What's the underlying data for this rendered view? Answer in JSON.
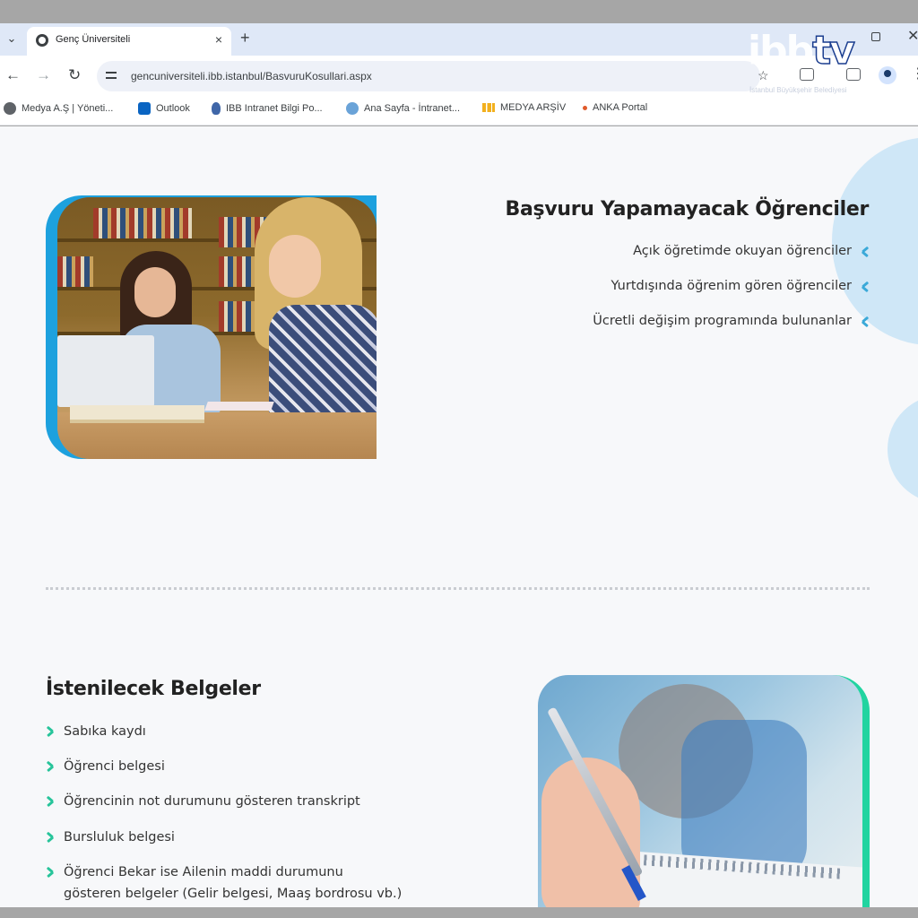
{
  "browser": {
    "tab_title": "Genç Üniversiteli",
    "tab_close": "×",
    "new_tab": "+",
    "tab_menu": "⌄",
    "url": "gencuniversiteli.ibb.istanbul/BasvuruKosullari.aspx",
    "nav": {
      "back": "←",
      "forward": "→",
      "reload": "↻"
    },
    "star": "☆",
    "kebab": "⋮",
    "window_close": "✕"
  },
  "bookmarks": [
    {
      "label": "Medya A.Ş | Yöneti...",
      "icon": "globe-icon"
    },
    {
      "label": "Outlook",
      "icon": "outlook-icon"
    },
    {
      "label": "IBB Intranet Bilgi Po...",
      "icon": "tulip-icon"
    },
    {
      "label": "Ana Sayfa - İntranet...",
      "icon": "intranet-icon"
    },
    {
      "label": "MEDYA ARŞİV",
      "icon": "archive-icon"
    },
    {
      "label": "ANKA Portal",
      "icon": "anka-icon"
    }
  ],
  "watermark": {
    "brand": "ibb",
    "suffix": "tv",
    "tagline": "İstanbul Büyükşehir Belediyesi"
  },
  "section1": {
    "title": "Başvuru Yapamayacak Öğrenciler",
    "items": [
      "Açık öğretimde okuyan öğrenciler",
      "Yurtdışında öğrenim gören öğrenciler",
      "Ücretli değişim programında bulunanlar"
    ]
  },
  "section2": {
    "title": "İstenilecek Belgeler",
    "items": [
      "Sabıka kaydı",
      "Öğrenci belgesi",
      "Öğrencinin not durumunu gösteren transkript",
      "Bursluluk belgesi",
      "Öğrenci Bekar ise Ailenin maddi durumunu",
      "gösteren belgeler (Gelir belgesi, Maaş bordrosu vb.)"
    ]
  },
  "colors": {
    "accent_blue": "#1da1de",
    "accent_green": "#21d4a0",
    "page_bg": "#f7f8fa",
    "blob": "#cfe7f7"
  }
}
